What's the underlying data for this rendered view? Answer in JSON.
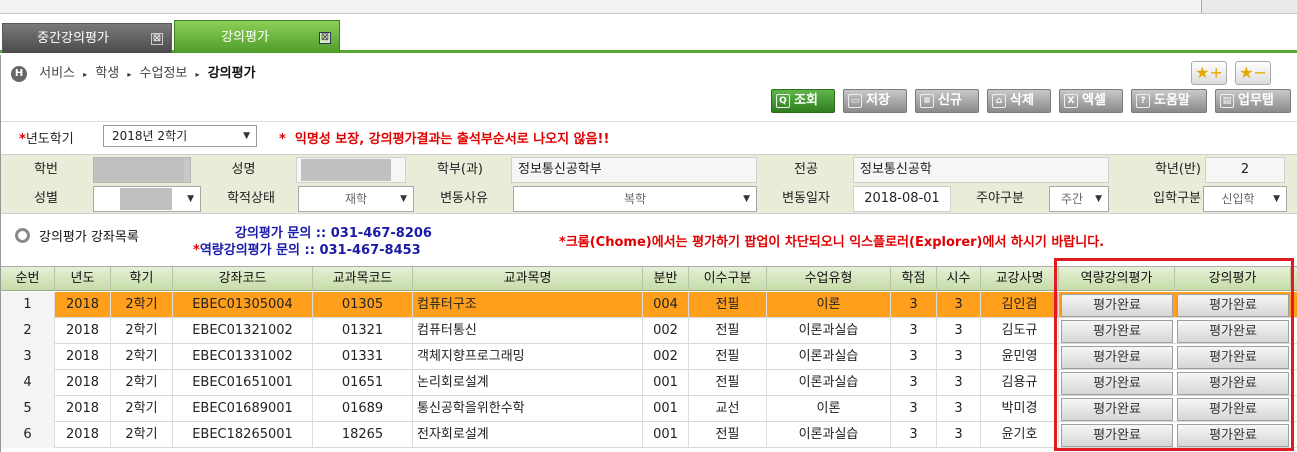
{
  "tabs": [
    {
      "label": "중간강의평가",
      "close": "⊠"
    },
    {
      "label": "강의평가",
      "close": "⊠"
    }
  ],
  "breadcrumb": {
    "home_icon": "H",
    "items": [
      "서비스",
      "학생",
      "수업정보"
    ],
    "current": "강의평가",
    "separator": "▸"
  },
  "favorites": {
    "add_icon": "★+",
    "remove_icon": "★−"
  },
  "toolbar": {
    "search": "조회",
    "save": "저장",
    "new": "신규",
    "delete": "삭제",
    "excel": "엑셀",
    "help": "도움말",
    "manual": "업무탭"
  },
  "term": {
    "label": "년도학기",
    "value": "2018년 2학기",
    "notice": "익명성 보장, 강의평가결과는 출석부순서로 나오지 않음!!"
  },
  "student": {
    "student_no_label": "학번",
    "name_label": "성명",
    "dept_label": "학부(과)",
    "dept_value": "정보통신공학부",
    "major_label": "전공",
    "major_value": "정보통신공학",
    "grade_label": "학년(반)",
    "grade_value": "2",
    "gender_label": "성별",
    "status_label": "학적상태",
    "status_value": "재학",
    "change_reason_label": "변동사유",
    "change_reason_value": "복학",
    "change_date_label": "변동일자",
    "change_date_value": "2018-08-01",
    "daynight_label": "주야구분",
    "daynight_value": "주간",
    "admission_label": "입학구분",
    "admission_value": "신입학"
  },
  "list": {
    "title": "강의평가 강좌목록",
    "contact1": "강의평가 문의 :: 031-467-8206",
    "contact2": "역량강의평가 문의 :: 031-467-8453",
    "chrome_notice": "크롬(Chome)에서는 평가하기 팝업이 차단되오니 익스플로러(Explorer)에서 하시기 바랍니다."
  },
  "grid": {
    "headers": [
      "순번",
      "년도",
      "학기",
      "강좌코드",
      "교과목코드",
      "교과목명",
      "분반",
      "이수구분",
      "수업유형",
      "학점",
      "시수",
      "교강사명",
      "역량강의평가",
      "강의평가"
    ],
    "rows": [
      {
        "no": "1",
        "year": "2018",
        "term": "2학기",
        "code": "EBEC01305004",
        "subj_code": "01305",
        "subj": "컴퓨터구조",
        "sec": "004",
        "type": "전필",
        "class_type": "이론",
        "credit": "3",
        "hours": "3",
        "prof": "김인겸",
        "ev1": "평가완료",
        "ev2": "평가완료"
      },
      {
        "no": "2",
        "year": "2018",
        "term": "2학기",
        "code": "EBEC01321002",
        "subj_code": "01321",
        "subj": "컴퓨터통신",
        "sec": "002",
        "type": "전필",
        "class_type": "이론과실습",
        "credit": "3",
        "hours": "3",
        "prof": "김도규",
        "ev1": "평가완료",
        "ev2": "평가완료"
      },
      {
        "no": "3",
        "year": "2018",
        "term": "2학기",
        "code": "EBEC01331002",
        "subj_code": "01331",
        "subj": "객체지향프로그래밍",
        "sec": "002",
        "type": "전필",
        "class_type": "이론과실습",
        "credit": "3",
        "hours": "3",
        "prof": "윤민영",
        "ev1": "평가완료",
        "ev2": "평가완료"
      },
      {
        "no": "4",
        "year": "2018",
        "term": "2학기",
        "code": "EBEC01651001",
        "subj_code": "01651",
        "subj": "논리회로설계",
        "sec": "001",
        "type": "전필",
        "class_type": "이론과실습",
        "credit": "3",
        "hours": "3",
        "prof": "김용규",
        "ev1": "평가완료",
        "ev2": "평가완료"
      },
      {
        "no": "5",
        "year": "2018",
        "term": "2학기",
        "code": "EBEC01689001",
        "subj_code": "01689",
        "subj": "통신공학을위한수학",
        "sec": "001",
        "type": "교선",
        "class_type": "이론",
        "credit": "3",
        "hours": "3",
        "prof": "박미경",
        "ev1": "평가완료",
        "ev2": "평가완료"
      },
      {
        "no": "6",
        "year": "2018",
        "term": "2학기",
        "code": "EBEC18265001",
        "subj_code": "18265",
        "subj": "전자회로설계",
        "sec": "001",
        "type": "전필",
        "class_type": "이론과실습",
        "credit": "3",
        "hours": "3",
        "prof": "윤기호",
        "ev1": "평가완료",
        "ev2": "평가완료"
      }
    ]
  },
  "colors": {
    "accent_green": "#5aa632",
    "selected_row": "#ff9f1c",
    "highlight_box": "#e11b22",
    "notice_red": "#e00000",
    "contact_blue": "#1a1aa8"
  }
}
